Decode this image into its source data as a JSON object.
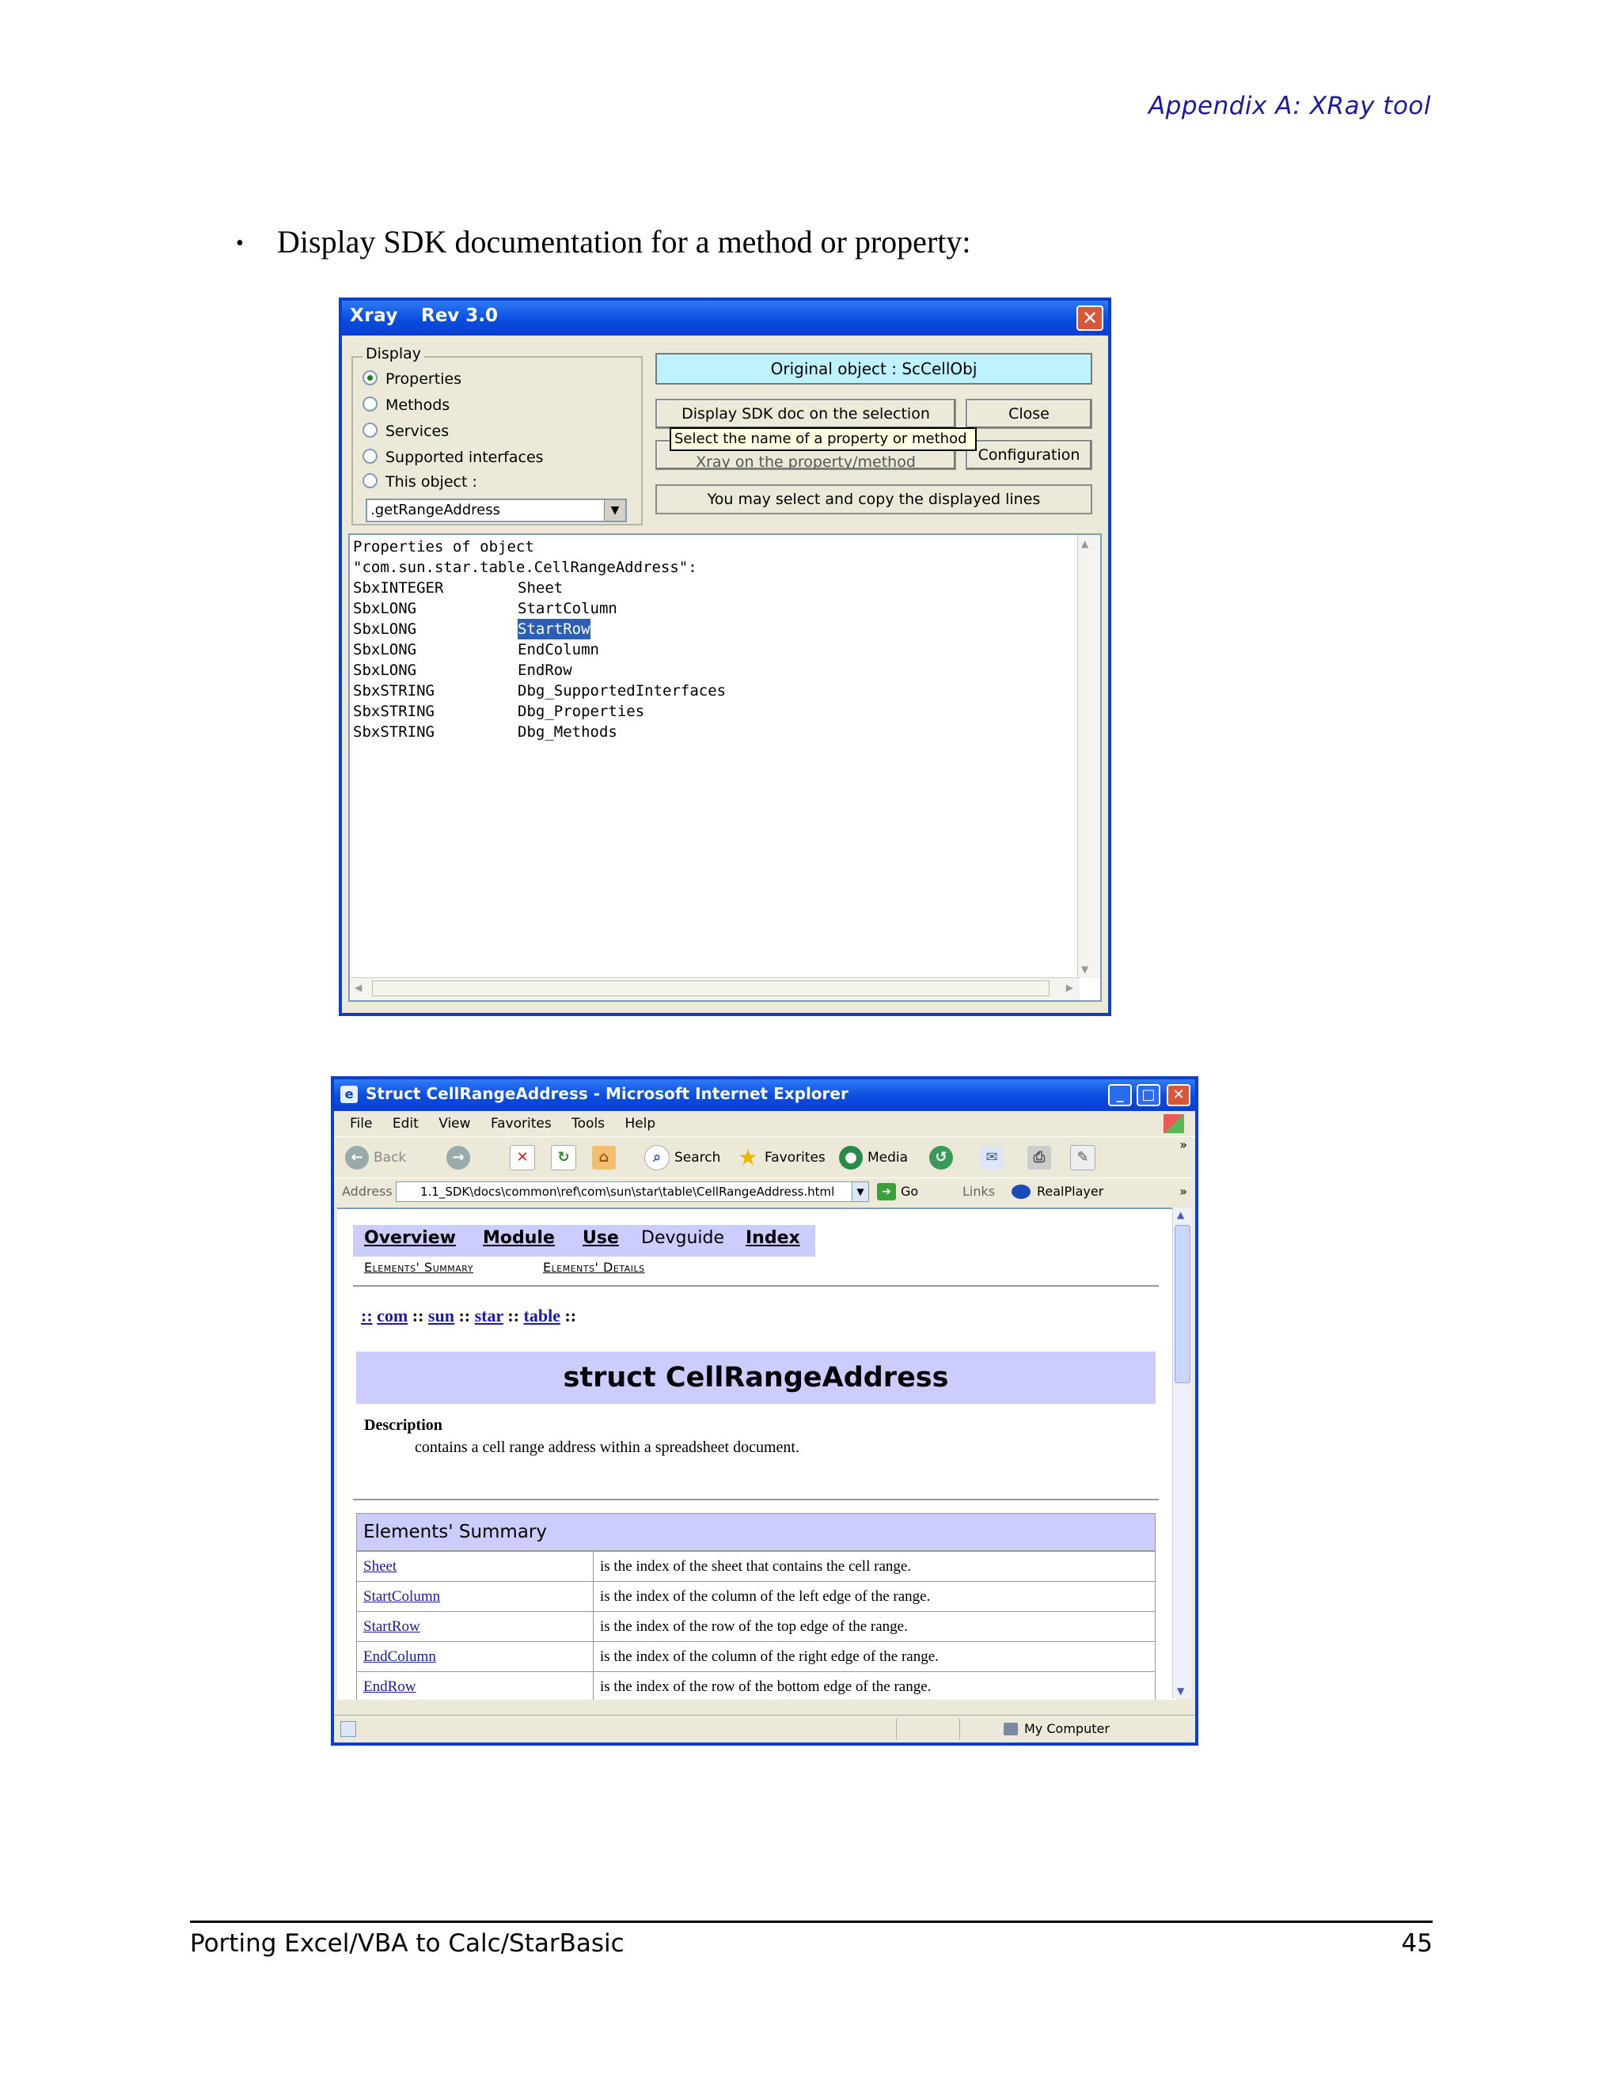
{
  "header": {
    "title": "Appendix A:  XRay tool"
  },
  "bullet": {
    "text": "Display SDK documentation for a method or property:"
  },
  "xray": {
    "title": "Xray",
    "rev": "Rev 3.0",
    "display_label": "Display",
    "options": [
      {
        "label": "Properties",
        "selected": true
      },
      {
        "label": "Methods",
        "selected": false
      },
      {
        "label": "Services",
        "selected": false
      },
      {
        "label": "Supported interfaces",
        "selected": false
      },
      {
        "label": "This object :",
        "selected": false
      }
    ],
    "combo_value": ".getRangeAddress",
    "original_object": "Original object : ScCellObj",
    "btn_display_sdk": "Display SDK doc on the selection",
    "btn_close": "Close",
    "tooltip": "Select the name of a property or method",
    "btn_xray_hidden": "Xray on the property/method",
    "btn_configuration": "Configuration",
    "message": "You may select and copy the displayed lines",
    "text_header_1": "Properties of object",
    "text_header_2": "\"com.sun.star.table.CellRangeAddress\":",
    "rows": [
      {
        "type": "SbxINTEGER",
        "name": "Sheet"
      },
      {
        "type": "SbxLONG",
        "name": "StartColumn"
      },
      {
        "type": "SbxLONG",
        "name": "StartRow",
        "highlighted": true
      },
      {
        "type": "SbxLONG",
        "name": "EndColumn"
      },
      {
        "type": "SbxLONG",
        "name": "EndRow"
      },
      {
        "type": "SbxSTRING",
        "name": "Dbg_SupportedInterfaces"
      },
      {
        "type": "SbxSTRING",
        "name": "Dbg_Properties"
      },
      {
        "type": "SbxSTRING",
        "name": "Dbg_Methods"
      }
    ]
  },
  "ie": {
    "title": "Struct CellRangeAddress - Microsoft Internet Explorer",
    "menu": [
      "File",
      "Edit",
      "View",
      "Favorites",
      "Tools",
      "Help"
    ],
    "toolbar": {
      "back": "Back",
      "search": "Search",
      "favorites": "Favorites",
      "media": "Media"
    },
    "address_label": "Address",
    "address_value": "1.1_SDK\\docs\\common\\ref\\com\\sun\\star\\table\\CellRangeAddress.html",
    "go": "Go",
    "links": "Links",
    "realplayer": "RealPlayer",
    "status_zone": "My Computer",
    "page": {
      "nav": [
        "Overview",
        "Module",
        "Use",
        "Devguide",
        "Index"
      ],
      "subnav": [
        "Elements' Summary",
        "Elements' Details"
      ],
      "breadcrumb": [
        "::",
        "com",
        "::",
        "sun",
        "::",
        "star",
        "::",
        "table",
        "::"
      ],
      "struct_title": "struct CellRangeAddress",
      "description_label": "Description",
      "description_text": "contains a cell range address within a spreadsheet document.",
      "summary_title": "Elements' Summary",
      "summary": [
        {
          "name": "Sheet",
          "desc": "is the index of the sheet that contains the cell range."
        },
        {
          "name": "StartColumn",
          "desc": "is the index of the column of the left edge of the range."
        },
        {
          "name": "StartRow",
          "desc": "is the index of the row of the top edge of the range."
        },
        {
          "name": "EndColumn",
          "desc": "is the index of the column of the right edge of the range."
        },
        {
          "name": "EndRow",
          "desc": "is the index of the row of the bottom edge of the range."
        }
      ]
    }
  },
  "footer": {
    "left": "Porting Excel/VBA to Calc/StarBasic",
    "page_number": "45"
  }
}
